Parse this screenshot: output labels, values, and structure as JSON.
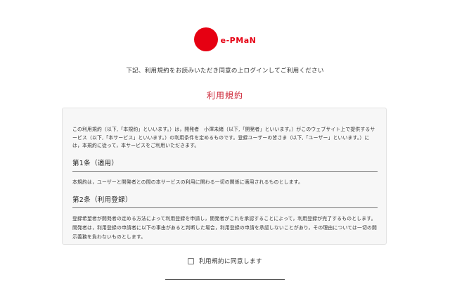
{
  "brand": {
    "name": "e-PMaN",
    "color": "#e60012"
  },
  "instruction": "下記、利用規約をお読みいただき同意の上ログインしてご利用ください",
  "terms": {
    "title": "利用規約",
    "intro": "この利用規約（以下,「本規約」といいます。）は，開発者　小澤未緒（以下,「開発者」といいます。）がこのウェブサイト上で提供するサービス（以下,「本サービス」といいます。）の利用条件を定めるものです。登録ユーザーの皆さま（以下,「ユーザー」といいます。）には，本規約に従って，本サービスをご利用いただきます。",
    "articles": [
      {
        "heading": "第1条（適用）",
        "body": "本規約は，ユーザーと開発者との間の本サービスの利用に関わる一切の関係に適用されるものとします。"
      },
      {
        "heading": "第2条（利用登録）",
        "body": "登録希望者が開発者の定める方法によって利用登録を申請し，開発者がこれを承認することによって，利用登録が完了するものとします。開発者は，利用登録の申請者に以下の事由があると判断した場合，利用登録の申請を承認しないことがあり，その理由については一切の開示義務を負わないものとします。"
      }
    ]
  },
  "agreement": {
    "label": "利用規約に同意します",
    "checked": false
  }
}
